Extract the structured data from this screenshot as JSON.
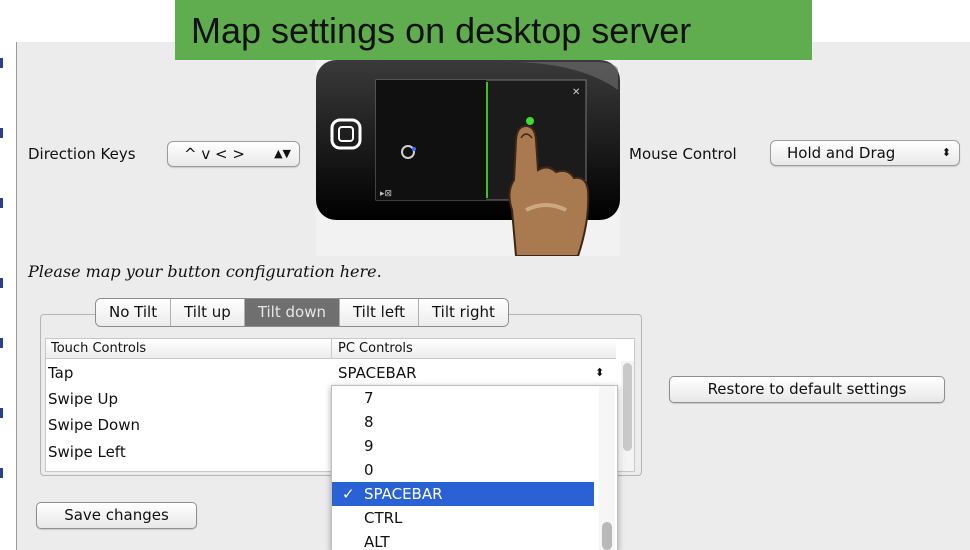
{
  "banner": {
    "title": "Map settings on desktop server",
    "color": "#5fad4e"
  },
  "direction_keys": {
    "label": "Direction Keys",
    "value": "^ v < >"
  },
  "mouse_control": {
    "label": "Mouse Control",
    "value": "Hold and Drag"
  },
  "select_arrows_icon": "up-down-chevrons-icon",
  "instruction": "Please map your button configuration here.",
  "tabs": [
    {
      "label": "No Tilt",
      "active": false
    },
    {
      "label": "Tilt up",
      "active": false
    },
    {
      "label": "Tilt down",
      "active": true
    },
    {
      "label": "Tilt left",
      "active": false
    },
    {
      "label": "Tilt right",
      "active": false
    }
  ],
  "table": {
    "headers": [
      "Touch Controls",
      "PC Controls"
    ],
    "rows": [
      {
        "touch": "Tap",
        "pc": "SPACEBAR"
      },
      {
        "touch": "Swipe Up",
        "pc": ""
      },
      {
        "touch": "Swipe Down",
        "pc": ""
      },
      {
        "touch": "Swipe Left",
        "pc": ""
      }
    ]
  },
  "dropdown": {
    "options": [
      "7",
      "8",
      "9",
      "0",
      "SPACEBAR",
      "CTRL",
      "ALT"
    ],
    "selected": "SPACEBAR",
    "check_mark": "✓",
    "selection_color": "#2a61d5"
  },
  "buttons": {
    "restore": "Restore to default settings",
    "save": "Save changes"
  }
}
